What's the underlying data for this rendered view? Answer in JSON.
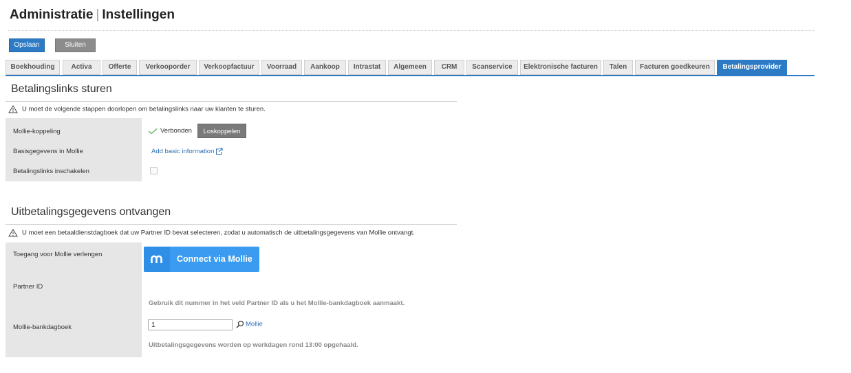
{
  "header": {
    "module": "Administratie",
    "separator": "|",
    "page": "Instellingen"
  },
  "toolbar": {
    "save_label": "Opslaan",
    "close_label": "Sluiten"
  },
  "tabs": [
    {
      "label": "Boekhouding"
    },
    {
      "label": "Activa"
    },
    {
      "label": "Offerte"
    },
    {
      "label": "Verkooporder"
    },
    {
      "label": "Verkoopfactuur"
    },
    {
      "label": "Voorraad"
    },
    {
      "label": "Aankoop"
    },
    {
      "label": "Intrastat"
    },
    {
      "label": "Algemeen"
    },
    {
      "label": "CRM"
    },
    {
      "label": "Scanservice"
    },
    {
      "label": "Elektronische facturen"
    },
    {
      "label": "Talen"
    },
    {
      "label": "Facturen goedkeuren"
    },
    {
      "label": "Betalingsprovider",
      "active": true
    }
  ],
  "payment_links": {
    "title": "Betalingslinks sturen",
    "warning": "U moet de volgende stappen doorlopen om betalingslinks naar uw klanten te sturen.",
    "mollie_link_label": "Mollie-koppeling",
    "status": "Verbonden",
    "disconnect_label": "Loskoppelen",
    "basic_info_label": "Basisgegevens in Mollie",
    "basic_info_link": "Add basic information",
    "enable_label": "Betalingslinks inschakelen",
    "enable_checked": false
  },
  "payouts": {
    "title": "Uitbetalingsgegevens ontvangen",
    "warning": "U moet een betaaldienstdagboek dat uw Partner ID bevat selecteren, zodat u automatisch de uitbetalingsgegevens van Mollie ontvangt.",
    "access_label": "Toegang voor Mollie verlengen",
    "connect_label": "Connect via Mollie",
    "partner_id_label": "Partner ID",
    "partner_id_hint": "Gebruik dit nummer in het veld Partner ID als u het Mollie-bankdagboek aanmaakt.",
    "bank_journal_label": "Mollie-bankdagboek",
    "bank_journal_value": "1",
    "bank_journal_lookup": "Mollie",
    "schedule_hint": "Uitbetalingsgegevens worden op werkdagen rond 13:00 opgehaald."
  },
  "colors": {
    "accent": "#2d7bc4",
    "mollie": "#3a9bf0",
    "success": "#5cb85c",
    "label_bg": "#e6e6e6"
  },
  "icons": {
    "warning": "warning-triangle-icon",
    "status": "check-icon",
    "external": "external-link-icon",
    "lookup": "search-icon",
    "mollie": "mollie-logo-icon"
  }
}
